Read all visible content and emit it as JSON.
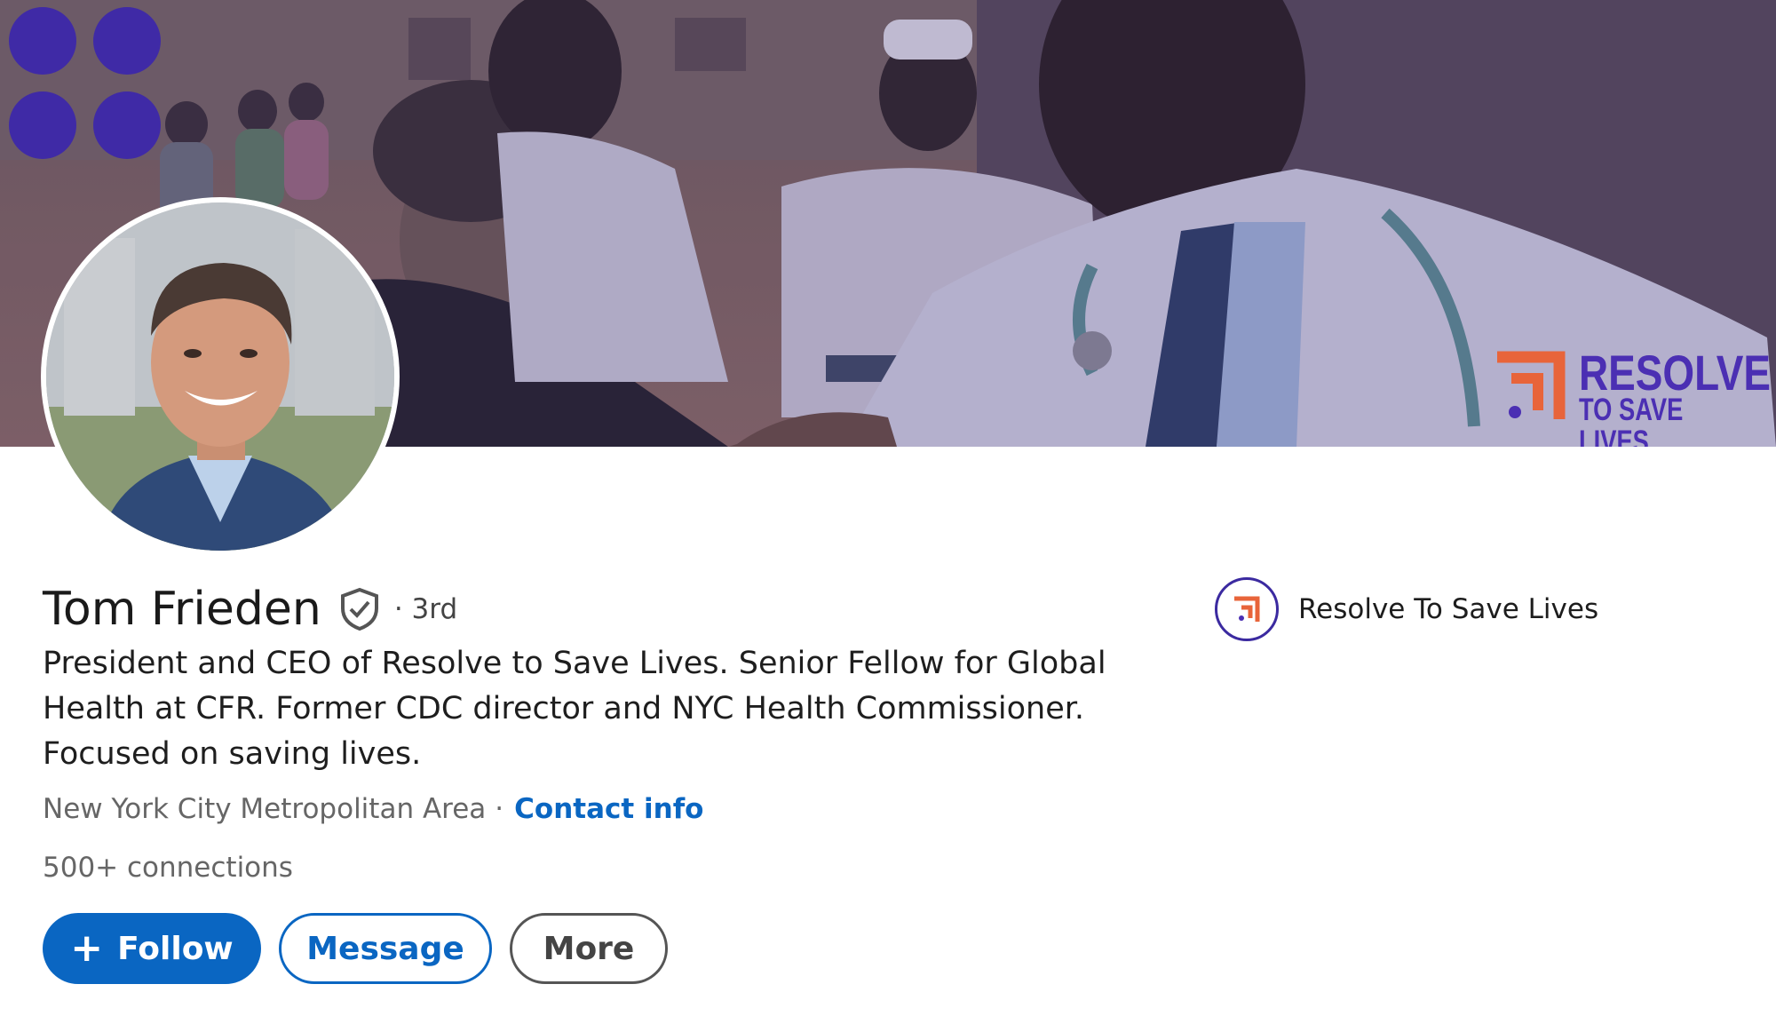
{
  "banner": {
    "org_logo": {
      "line1": "RESOLVE",
      "line2": "TO SAVE LIVES"
    },
    "colors": {
      "purple": "#3f2aa6",
      "orange": "#e8643a"
    }
  },
  "profile": {
    "name": "Tom Frieden",
    "verified_icon": "shield-check-icon",
    "degree": "· 3rd",
    "headline": "President and CEO of Resolve to Save Lives. Senior Fellow for Global Health at CFR. Former CDC director and NYC Health Commissioner. Focused on saving lives.",
    "location": "New York City Metropolitan Area",
    "separator": "·",
    "contact_label": "Contact info",
    "connections": "500+ connections"
  },
  "actions": {
    "follow_label": "Follow",
    "follow_icon": "plus-icon",
    "message_label": "Message",
    "more_label": "More"
  },
  "company": {
    "name": "Resolve To Save Lives"
  },
  "colors": {
    "primary_blue": "#0a66c2",
    "text_secondary": "#666666"
  }
}
